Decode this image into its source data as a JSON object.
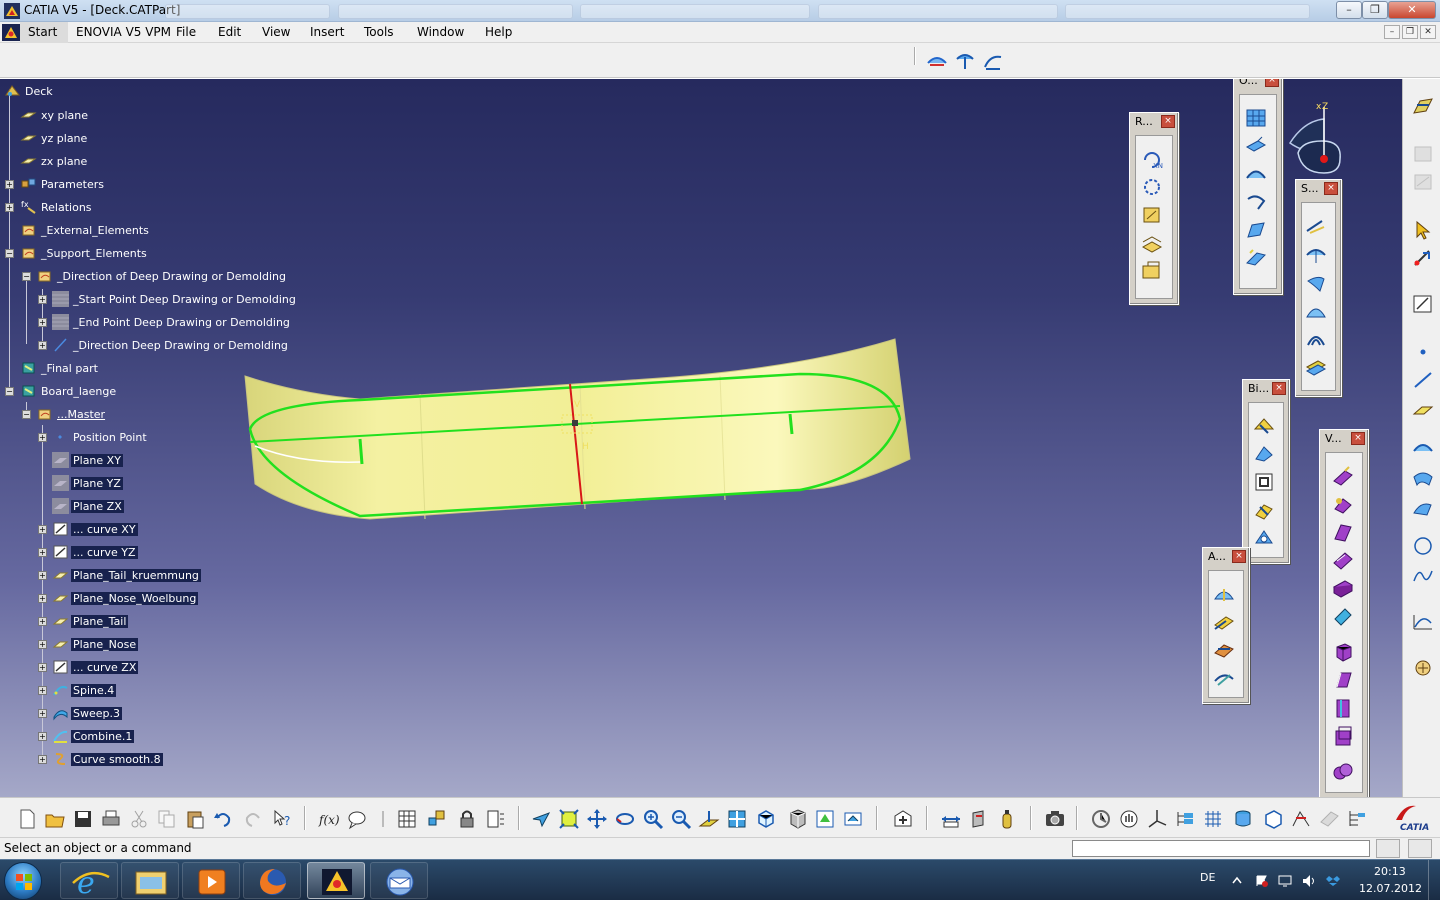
{
  "window": {
    "title": "CATIA V5 - [Deck.CATPart]",
    "min_symbol": "–",
    "restore_symbol": "❐",
    "close_symbol": "✕"
  },
  "menubar": {
    "items": [
      "Start",
      "ENOVIA V5 VPM",
      "File",
      "Edit",
      "View",
      "Insert",
      "Tools",
      "Window",
      "Help"
    ]
  },
  "tree": {
    "nodes": [
      {
        "label": "Deck",
        "icon": "part-icon"
      },
      {
        "label": "xy plane",
        "icon": "plane-icon"
      },
      {
        "label": "yz plane",
        "icon": "plane-icon"
      },
      {
        "label": "zx plane",
        "icon": "plane-icon"
      },
      {
        "label": "Parameters",
        "icon": "parameters-icon"
      },
      {
        "label": "Relations",
        "icon": "relations-icon"
      },
      {
        "label": "_External_Elements",
        "icon": "geometrical-set-icon"
      },
      {
        "label": "_Support_Elements",
        "icon": "geometrical-set-icon"
      },
      {
        "label": "_Direction of Deep Drawing or Demolding",
        "icon": "geometrical-set-icon"
      },
      {
        "label": "_Start Point Deep Drawing or Demolding",
        "icon": "point-icon"
      },
      {
        "label": "_End Point Deep Drawing or Demolding",
        "icon": "point-icon"
      },
      {
        "label": "_Direction Deep Drawing or Demolding",
        "icon": "line-icon"
      },
      {
        "label": "_Final part",
        "icon": "body-icon"
      },
      {
        "label": "Board_laenge",
        "icon": "body-icon"
      },
      {
        "label": "...Master",
        "icon": "geometrical-set-icon"
      },
      {
        "label": "Position Point",
        "icon": "point-icon"
      },
      {
        "label": "Plane XY",
        "icon": "plane-icon"
      },
      {
        "label": "Plane YZ",
        "icon": "plane-icon"
      },
      {
        "label": "Plane ZX",
        "icon": "plane-icon"
      },
      {
        "label": "... curve XY",
        "icon": "sketch-icon"
      },
      {
        "label": "... curve YZ",
        "icon": "sketch-icon"
      },
      {
        "label": "Plane_Tail_kruemmung",
        "icon": "plane-icon"
      },
      {
        "label": "Plane_Nose_Woelbung",
        "icon": "plane-icon"
      },
      {
        "label": "Plane_Tail",
        "icon": "plane-icon"
      },
      {
        "label": "Plane_Nose",
        "icon": "plane-icon"
      },
      {
        "label": "... curve ZX",
        "icon": "sketch-icon"
      },
      {
        "label": "Spine.4",
        "icon": "spine-icon"
      },
      {
        "label": "Sweep.3",
        "icon": "sweep-icon"
      },
      {
        "label": "Combine.1",
        "icon": "combine-icon"
      },
      {
        "label": "Curve smooth.8",
        "icon": "curve-smooth-icon"
      }
    ]
  },
  "float_toolbars": [
    {
      "title": "R...",
      "icon_count": 5
    },
    {
      "title": "O...",
      "icon_count": 6
    },
    {
      "title": "S...",
      "icon_count": 6
    },
    {
      "title": "Bi...",
      "icon_count": 5
    },
    {
      "title": "A...",
      "icon_count": 4
    },
    {
      "title": "V...",
      "icon_count": 11
    }
  ],
  "compass": {
    "axis_labels": [
      "x",
      "Z"
    ]
  },
  "status": {
    "message": "Select an object or a command"
  },
  "taskbar": {
    "language": "DE",
    "time": "20:13",
    "date": "12.07.2012"
  },
  "colors": {
    "selection_bg": "#18224e",
    "surface": "#f2ef96",
    "highlight_green": "#22e01e",
    "axis_red": "#d81818"
  }
}
